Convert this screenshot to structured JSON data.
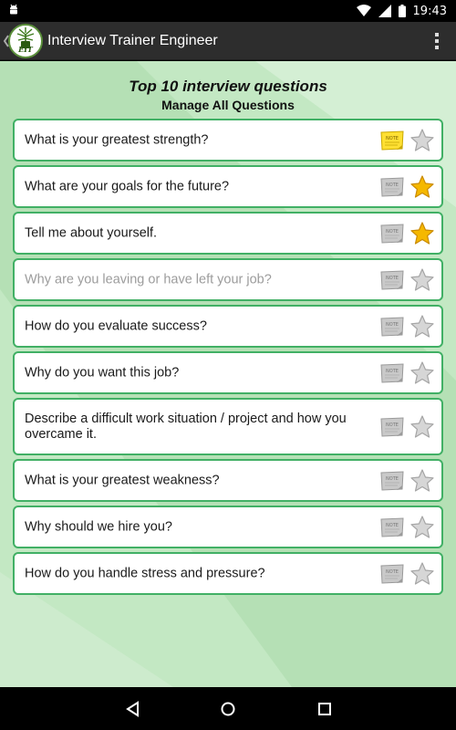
{
  "status_bar": {
    "time": "19:43"
  },
  "app": {
    "title": "Interview Trainer Engineer",
    "logo_text": "EIT"
  },
  "header": {
    "title": "Top 10 interview questions",
    "subtitle": "Manage All Questions"
  },
  "questions": [
    {
      "text": "What is your greatest strength?",
      "note": "active",
      "starred": false,
      "disabled": false
    },
    {
      "text": "What are your goals for the future?",
      "note": "inactive",
      "starred": true,
      "disabled": false
    },
    {
      "text": "Tell me about yourself.",
      "note": "inactive",
      "starred": true,
      "disabled": false
    },
    {
      "text": "Why are you leaving or have left your job?",
      "note": "inactive",
      "starred": false,
      "disabled": true
    },
    {
      "text": "How do you evaluate success?",
      "note": "inactive",
      "starred": false,
      "disabled": false
    },
    {
      "text": "Why do you want this job?",
      "note": "inactive",
      "starred": false,
      "disabled": false
    },
    {
      "text": "Describe a difficult work situation / project and how you overcame it.",
      "note": "inactive",
      "starred": false,
      "disabled": false
    },
    {
      "text": "What is your greatest weakness?",
      "note": "inactive",
      "starred": false,
      "disabled": false
    },
    {
      "text": "Why should we hire you?",
      "note": "inactive",
      "starred": false,
      "disabled": false
    },
    {
      "text": "How do you handle stress and pressure?",
      "note": "inactive",
      "starred": false,
      "disabled": false
    }
  ],
  "note_label": "NOTE",
  "colors": {
    "row_border": "#41b065",
    "background": "#c3e8c3",
    "star_active": "#f5b800",
    "note_active": "#ffe033"
  }
}
